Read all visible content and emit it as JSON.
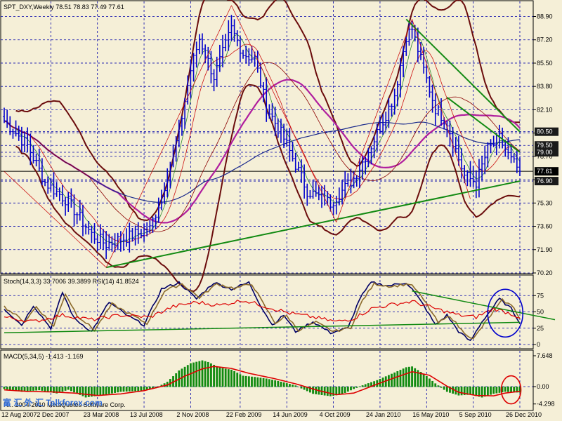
{
  "header": {
    "main_title": "SPT_DXY,Weekly  78.51 78.83 77.49 77.61",
    "stoch_title": "Stoch(14,3,3) 33.7006 39.3899  RSI(14) 41.8524",
    "macd_title": "MACD(5,34,5) -1.413 -1.169",
    "footer_text": "H... 2004-2010 MetaQuotes Software Corp.",
    "watermark": "富 汇 外 汇 Talkforex.com"
  },
  "chart_data": [
    {
      "type": "bar",
      "name": "price",
      "ylim": [
        70.2,
        90.0
      ],
      "price_labels": [
        "88.90",
        "87.20",
        "85.50",
        "83.80",
        "82.10",
        "80.40",
        "78.70",
        "77.00",
        "75.30",
        "73.60",
        "71.90",
        "70.20"
      ],
      "price_values": [
        88.9,
        87.2,
        85.5,
        83.8,
        82.1,
        80.4,
        78.7,
        77.0,
        75.3,
        73.6,
        71.9,
        70.2
      ],
      "marked_levels": [
        {
          "label": "80.50",
          "value": 80.5,
          "color": "#FFFFFF",
          "bg": "#1A1A1A"
        },
        {
          "label": "79.50",
          "value": 79.5,
          "color": "#FFFFFF",
          "bg": "#1A1A1A"
        },
        {
          "label": "79.00",
          "value": 79.0,
          "color": "#FFFFFF",
          "bg": "#1A1A1A"
        },
        {
          "label": "77.61",
          "value": 77.61,
          "color": "#FFFFFF",
          "bg": "#000000"
        },
        {
          "label": "76.90",
          "value": 76.9,
          "color": "#FFFFFF",
          "bg": "#1A1A1A"
        }
      ],
      "x_labels": [
        "12 Aug 2007",
        "2 Dec 2007",
        "23 Mar 2008",
        "13 Jul 2008",
        "2 Nov 2008",
        "22 Feb 2009",
        "14 Jun 2009",
        "4 Oct 2009",
        "24 Jan 2010",
        "16 May 2010",
        "5 Sep 2010",
        "26 Dec 2010"
      ],
      "weeks": 178,
      "close_anchors": [
        [
          0,
          81.3
        ],
        [
          8,
          79.5
        ],
        [
          14,
          76.8
        ],
        [
          22,
          75.4
        ],
        [
          30,
          73.0
        ],
        [
          35,
          72.3
        ],
        [
          42,
          72.8
        ],
        [
          50,
          73.4
        ],
        [
          54,
          75.8
        ],
        [
          60,
          80.5
        ],
        [
          64,
          85.0
        ],
        [
          67,
          87.3
        ],
        [
          72,
          84.5
        ],
        [
          76,
          86.8
        ],
        [
          78,
          88.0
        ],
        [
          82,
          86.2
        ],
        [
          86,
          85.8
        ],
        [
          90,
          82.3
        ],
        [
          96,
          80.0
        ],
        [
          104,
          76.2
        ],
        [
          112,
          75.3
        ],
        [
          116,
          76.2
        ],
        [
          120,
          77.1
        ],
        [
          126,
          79.5
        ],
        [
          130,
          81.3
        ],
        [
          134,
          83.2
        ],
        [
          138,
          87.5
        ],
        [
          140,
          88.0
        ],
        [
          144,
          85.0
        ],
        [
          148,
          82.2
        ],
        [
          152,
          81.2
        ],
        [
          156,
          78.5
        ],
        [
          158,
          77.3
        ],
        [
          162,
          76.8
        ],
        [
          166,
          79.2
        ],
        [
          170,
          80.0
        ],
        [
          174,
          78.4
        ],
        [
          177,
          77.61
        ]
      ],
      "colors": {
        "bars": "#0000CC",
        "grid": "#0000AA",
        "bb": "#6B0D0D",
        "ma_magenta": "#B01E9E",
        "ma_navy": "#1A2A8C",
        "ma_red": "#CC1111",
        "trend": "#128A12",
        "price_line": "#000000"
      }
    },
    {
      "type": "line",
      "name": "stoch_rsi",
      "ylim": [
        0,
        100
      ],
      "y_labels": [
        "75",
        "50",
        "25",
        "0"
      ],
      "y_values": [
        75,
        50,
        25,
        0
      ],
      "series": [
        {
          "name": "Stoch %K",
          "color": "#000066",
          "anchors": [
            [
              0,
              55
            ],
            [
              6,
              30
            ],
            [
              10,
              60
            ],
            [
              16,
              25
            ],
            [
              20,
              80
            ],
            [
              24,
              40
            ],
            [
              30,
              20
            ],
            [
              36,
              65
            ],
            [
              42,
              45
            ],
            [
              48,
              30
            ],
            [
              54,
              85
            ],
            [
              60,
              95
            ],
            [
              66,
              70
            ],
            [
              72,
              95
            ],
            [
              78,
              85
            ],
            [
              84,
              95
            ],
            [
              88,
              60
            ],
            [
              92,
              30
            ],
            [
              96,
              45
            ],
            [
              100,
              20
            ],
            [
              106,
              35
            ],
            [
              112,
              18
            ],
            [
              118,
              25
            ],
            [
              122,
              70
            ],
            [
              126,
              95
            ],
            [
              132,
              90
            ],
            [
              138,
              95
            ],
            [
              140,
              85
            ],
            [
              144,
              60
            ],
            [
              148,
              30
            ],
            [
              152,
              45
            ],
            [
              156,
              20
            ],
            [
              160,
              5
            ],
            [
              164,
              35
            ],
            [
              170,
              70
            ],
            [
              174,
              55
            ],
            [
              177,
              34
            ]
          ]
        },
        {
          "name": "Stoch %D",
          "color": "#8B6A2A",
          "anchors": [
            [
              0,
              58
            ],
            [
              7,
              35
            ],
            [
              11,
              58
            ],
            [
              17,
              28
            ],
            [
              21,
              78
            ],
            [
              25,
              45
            ],
            [
              31,
              22
            ],
            [
              37,
              62
            ],
            [
              43,
              47
            ],
            [
              49,
              32
            ],
            [
              55,
              82
            ],
            [
              61,
              93
            ],
            [
              67,
              72
            ],
            [
              73,
              93
            ],
            [
              79,
              86
            ],
            [
              85,
              93
            ],
            [
              89,
              62
            ],
            [
              93,
              33
            ],
            [
              97,
              44
            ],
            [
              101,
              22
            ],
            [
              107,
              34
            ],
            [
              113,
              20
            ],
            [
              119,
              26
            ],
            [
              123,
              68
            ],
            [
              127,
              93
            ],
            [
              133,
              89
            ],
            [
              139,
              93
            ],
            [
              141,
              86
            ],
            [
              145,
              62
            ],
            [
              149,
              33
            ],
            [
              153,
              44
            ],
            [
              157,
              22
            ],
            [
              161,
              8
            ],
            [
              165,
              33
            ],
            [
              171,
              68
            ],
            [
              175,
              57
            ],
            [
              177,
              39
            ]
          ]
        },
        {
          "name": "RSI",
          "color": "#DD0000",
          "anchors": [
            [
              0,
              42
            ],
            [
              10,
              35
            ],
            [
              20,
              45
            ],
            [
              30,
              38
            ],
            [
              40,
              45
            ],
            [
              50,
              42
            ],
            [
              58,
              58
            ],
            [
              66,
              65
            ],
            [
              74,
              60
            ],
            [
              82,
              68
            ],
            [
              90,
              58
            ],
            [
              98,
              48
            ],
            [
              106,
              42
            ],
            [
              114,
              35
            ],
            [
              120,
              40
            ],
            [
              126,
              55
            ],
            [
              134,
              62
            ],
            [
              140,
              66
            ],
            [
              148,
              55
            ],
            [
              156,
              45
            ],
            [
              162,
              42
            ],
            [
              168,
              55
            ],
            [
              172,
              50
            ],
            [
              177,
              42
            ]
          ]
        }
      ],
      "colors": {
        "trend": "#128A12",
        "circle": "#0000CC",
        "grid": "#0000AA"
      }
    },
    {
      "type": "bar",
      "name": "macd",
      "ylim": [
        -5.0,
        8.2
      ],
      "y_labels": [
        "7.648",
        "0.00",
        "-4.298"
      ],
      "y_values": [
        7.648,
        0.0,
        -4.298
      ],
      "hist_anchors": [
        [
          0,
          -0.5
        ],
        [
          6,
          -1.2
        ],
        [
          12,
          -0.8
        ],
        [
          18,
          -1.6
        ],
        [
          22,
          -0.7
        ],
        [
          28,
          -2.6
        ],
        [
          34,
          -2.0
        ],
        [
          40,
          -1.2
        ],
        [
          46,
          -1.0
        ],
        [
          52,
          -0.3
        ],
        [
          56,
          1.2
        ],
        [
          60,
          4.0
        ],
        [
          64,
          5.8
        ],
        [
          68,
          6.5
        ],
        [
          70,
          6.1
        ],
        [
          74,
          4.7
        ],
        [
          78,
          4.2
        ],
        [
          82,
          2.7
        ],
        [
          86,
          2.4
        ],
        [
          90,
          2.0
        ],
        [
          94,
          1.4
        ],
        [
          100,
          0.3
        ],
        [
          106,
          -1.7
        ],
        [
          112,
          -2.3
        ],
        [
          116,
          -1.8
        ],
        [
          120,
          -0.5
        ],
        [
          124,
          0.6
        ],
        [
          128,
          1.6
        ],
        [
          134,
          3.5
        ],
        [
          138,
          4.8
        ],
        [
          140,
          5.0
        ],
        [
          144,
          3.2
        ],
        [
          148,
          0.8
        ],
        [
          152,
          -1.2
        ],
        [
          156,
          -2.1
        ],
        [
          160,
          -1.9
        ],
        [
          164,
          -2.6
        ],
        [
          168,
          -1.7
        ],
        [
          172,
          -1.2
        ],
        [
          177,
          -1.413
        ]
      ],
      "signal_anchors": [
        [
          0,
          -0.8
        ],
        [
          8,
          -1.2
        ],
        [
          16,
          -1.3
        ],
        [
          24,
          -1.6
        ],
        [
          32,
          -2.2
        ],
        [
          40,
          -1.8
        ],
        [
          48,
          -1.0
        ],
        [
          56,
          0.4
        ],
        [
          62,
          2.6
        ],
        [
          68,
          4.4
        ],
        [
          72,
          5.0
        ],
        [
          78,
          4.5
        ],
        [
          84,
          3.3
        ],
        [
          92,
          2.1
        ],
        [
          100,
          0.7
        ],
        [
          108,
          -1.0
        ],
        [
          114,
          -2.0
        ],
        [
          120,
          -1.6
        ],
        [
          128,
          0.6
        ],
        [
          134,
          2.2
        ],
        [
          140,
          3.7
        ],
        [
          146,
          2.8
        ],
        [
          152,
          0.1
        ],
        [
          156,
          -1.4
        ],
        [
          162,
          -2.2
        ],
        [
          168,
          -2.3
        ],
        [
          172,
          -1.6
        ],
        [
          177,
          -1.169
        ]
      ],
      "colors": {
        "hist": "#108A10",
        "signal": "#DD0000",
        "circle": "#DD0000"
      }
    }
  ]
}
